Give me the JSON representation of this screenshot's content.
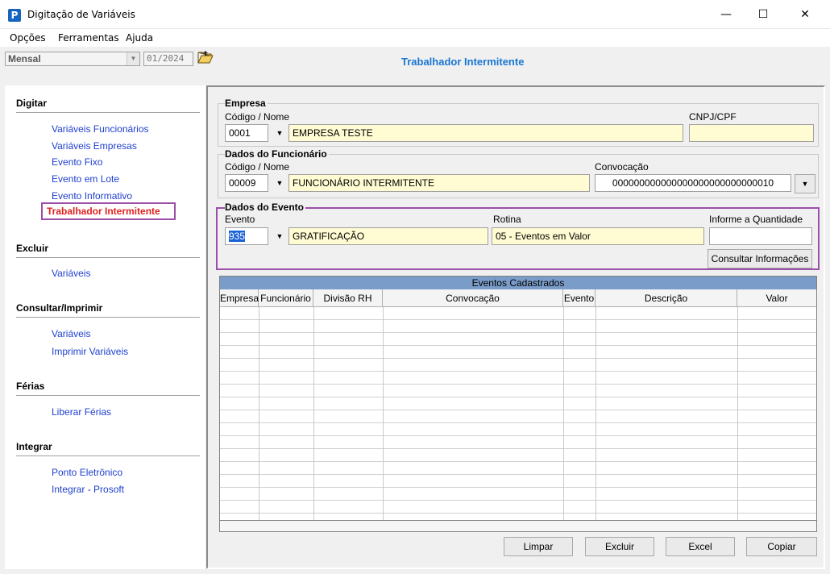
{
  "window": {
    "title": "Digitação de Variáveis",
    "minimize": "—",
    "maximize": "☐",
    "close": "✕"
  },
  "menu": [
    "Opções",
    "Ferramentas",
    "Ajuda"
  ],
  "toolbar": {
    "period": "Mensal",
    "date": "01/2024",
    "screen_title": "Trabalhador Intermitente"
  },
  "nav": {
    "digitar": {
      "heading": "Digitar",
      "items": [
        "Variáveis Funcionários",
        "Variáveis Empresas",
        "Evento Fixo",
        "Evento em Lote",
        "Evento Informativo"
      ],
      "active": "Trabalhador Intermitente"
    },
    "excluir": {
      "heading": "Excluir",
      "items": [
        "Variáveis"
      ]
    },
    "consultar": {
      "heading": "Consultar/Imprimir",
      "items": [
        "Variáveis",
        "Imprimir Variáveis"
      ]
    },
    "ferias": {
      "heading": "Férias",
      "items": [
        "Liberar Férias"
      ]
    },
    "integrar": {
      "heading": "Integrar",
      "items": [
        "Ponto Eletrônico",
        "Integrar - Prosoft"
      ]
    }
  },
  "empresa": {
    "group_title": "Empresa",
    "code_label": "Código / Nome",
    "code": "0001",
    "name": "EMPRESA TESTE",
    "cnpj_label": "CNPJ/CPF",
    "cnpj": ""
  },
  "funcionario": {
    "group_title": "Dados do Funcionário",
    "code_label": "Código / Nome",
    "code": "00009",
    "name": "FUNCIONÁRIO INTERMITENTE",
    "convocacao_label": "Convocação",
    "convocacao": "000000000000000000000000000010"
  },
  "evento": {
    "group_title": "Dados do Evento",
    "evento_label": "Evento",
    "code": "935",
    "name": "GRATIFICAÇÃO",
    "rotina_label": "Rotina",
    "rotina": "05 - Eventos em Valor",
    "quantidade_label": "Informe a Quantidade",
    "quantidade": "",
    "consultar_button": "Consultar Informações"
  },
  "grid": {
    "caption": "Eventos Cadastrados",
    "columns": [
      "Empresa",
      "Funcionário",
      "Divisão RH",
      "Convocação",
      "Evento",
      "Descrição",
      "Valor"
    ],
    "rows": []
  },
  "buttons": {
    "limpar": "Limpar",
    "excluir": "Excluir",
    "excel": "Excel",
    "copiar": "Copiar"
  },
  "colors": {
    "link": "#1e3fcf",
    "active": "#e02020",
    "highlight": "#9b4fa9",
    "title": "#1976d2",
    "field_yellow": "#fffbd2",
    "grid_caption": "#7a9cc8"
  }
}
